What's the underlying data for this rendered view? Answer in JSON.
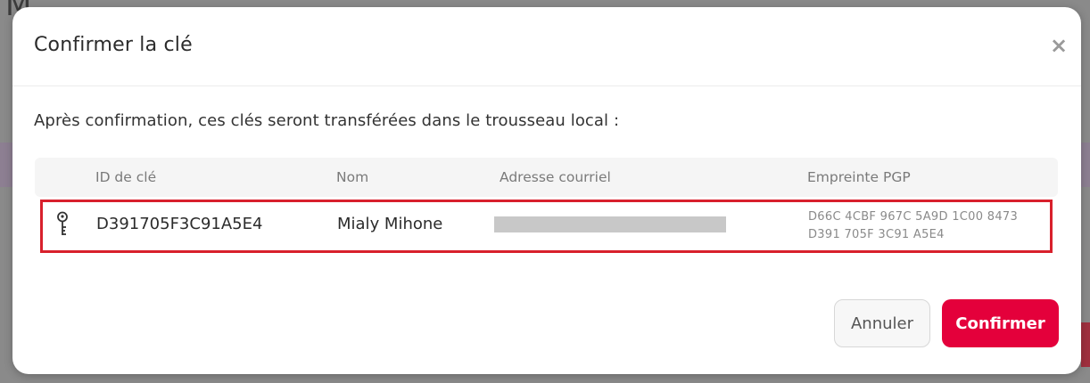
{
  "background": {
    "title_fragment": "Mailvelope"
  },
  "dialog": {
    "title": "Confirmer la clé",
    "close_symbol": "×",
    "intro": "Après confirmation, ces clés seront transférées dans le trousseau local :",
    "table": {
      "headers": [
        "ID de clé",
        "Nom",
        "Adresse courriel",
        "Empreinte PGP"
      ],
      "rows": [
        {
          "icon": "key-icon",
          "key_id": "D391705F3C91A5E4",
          "name": "Mialy Mihone",
          "email": "",
          "fingerprint_line1": "D66C 4CBF 967C 5A9D 1C00 8473",
          "fingerprint_line2": "D391 705F 3C91 A5E4"
        }
      ]
    },
    "buttons": {
      "cancel": "Annuler",
      "confirm": "Confirmer"
    }
  },
  "colors": {
    "accent": "#e4003b",
    "highlight_border": "#d8202c"
  }
}
